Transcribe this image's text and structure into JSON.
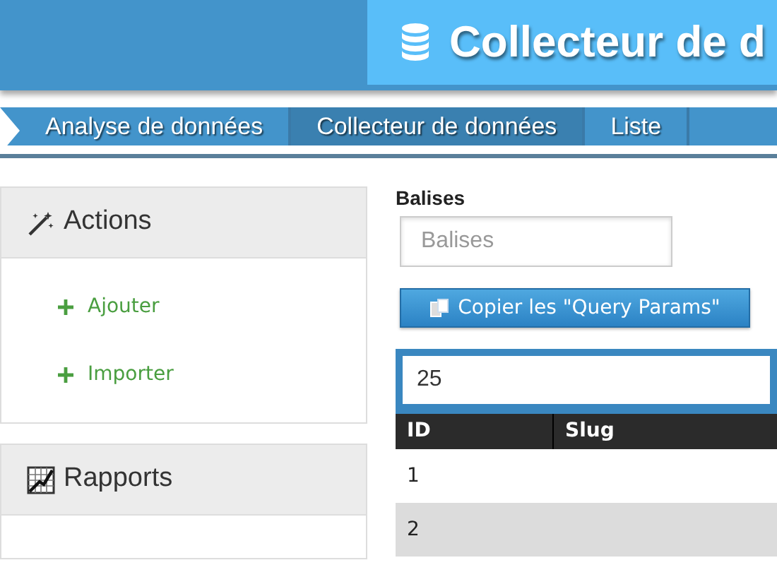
{
  "header": {
    "title": "Collecteur de d"
  },
  "breadcrumb": [
    {
      "label": "Analyse de données",
      "selected": false
    },
    {
      "label": "Collecteur de données",
      "selected": true
    },
    {
      "label": "Liste",
      "selected": false
    }
  ],
  "sidebar": [
    {
      "title": "Actions",
      "kind": "actions",
      "items": [
        "Ajouter",
        "Importer"
      ]
    },
    {
      "title": "Rapports",
      "kind": "reports"
    }
  ],
  "filter": {
    "label": "Balises",
    "placeholder": "Balises"
  },
  "copy_button": "Copier les \"Query Params\"",
  "page_size": "25",
  "table": {
    "columns": [
      "ID",
      "Slug"
    ],
    "rows": [
      {
        "id": "1",
        "selected": false
      },
      {
        "id": "2",
        "selected": true
      }
    ]
  }
}
